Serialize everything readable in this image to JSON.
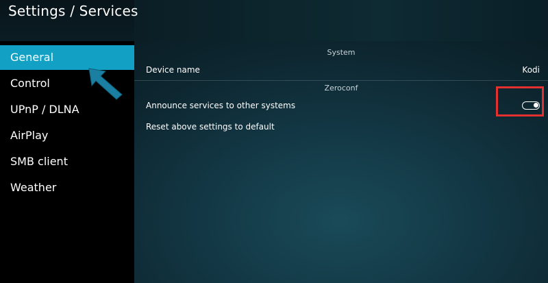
{
  "header": {
    "title": "Settings / Services"
  },
  "sidebar": {
    "items": [
      {
        "label": "General",
        "active": true
      },
      {
        "label": "Control",
        "active": false
      },
      {
        "label": "UPnP / DLNA",
        "active": false
      },
      {
        "label": "AirPlay",
        "active": false
      },
      {
        "label": "SMB client",
        "active": false
      },
      {
        "label": "Weather",
        "active": false
      }
    ]
  },
  "main": {
    "sections": [
      {
        "header": "System",
        "rows": [
          {
            "label": "Device name",
            "value": "Kodi"
          }
        ]
      },
      {
        "header": "Zeroconf",
        "rows": [
          {
            "label": "Announce services to other systems",
            "toggle_on": true
          },
          {
            "label": "Reset above settings to default"
          }
        ]
      }
    ]
  },
  "colors": {
    "accent": "#12a0c4",
    "sidebar_bg": "#000000",
    "highlight": "#e53030",
    "arrow": "#1a7fa0"
  },
  "icons": {
    "annotation_arrow": "arrow-pointer-icon",
    "toggle": "toggle-switch-icon"
  }
}
